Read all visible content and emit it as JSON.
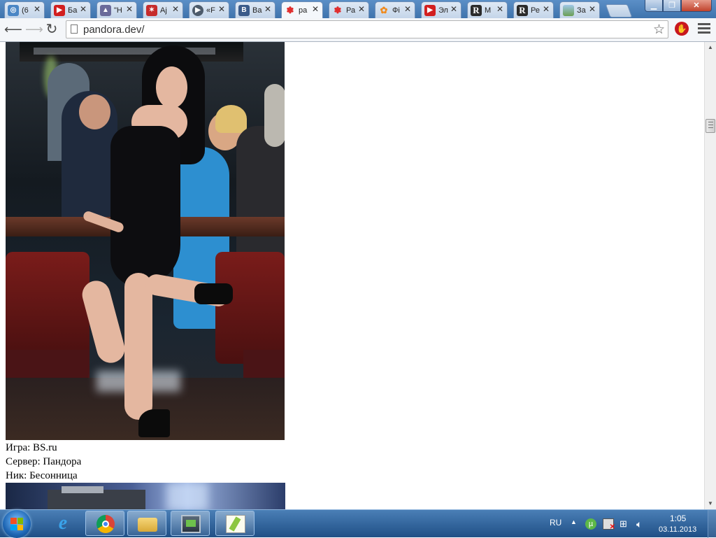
{
  "browser": {
    "tabs": [
      {
        "label": "(6",
        "icon": "chrome-app-icon",
        "color": "#4a86c5"
      },
      {
        "label": "Ба",
        "icon": "youtube-icon",
        "color": "#d21f1f"
      },
      {
        "label": "\"Н",
        "icon": "site-icon",
        "color": "#6a6a9a"
      },
      {
        "label": "Ај",
        "icon": "red-site-icon",
        "color": "#c62c2c"
      },
      {
        "label": "«F",
        "icon": "play-circle-icon",
        "color": "#4d5b6b"
      },
      {
        "label": "Ва",
        "icon": "vk-icon",
        "color": "#3b5b8a"
      },
      {
        "label": "ра",
        "icon": "yandex-icon",
        "color": "#e02d2d",
        "active": true
      },
      {
        "label": "Ра",
        "icon": "yandex-icon",
        "color": "#e02d2d"
      },
      {
        "label": "Фі",
        "icon": "flower-icon",
        "color": "#f08a1c"
      },
      {
        "label": "Эл",
        "icon": "youtube-icon",
        "color": "#d21f1f"
      },
      {
        "label": "М",
        "icon": "r-letter-icon",
        "color": "#2b2b2b"
      },
      {
        "label": "Ре",
        "icon": "r-letter-icon",
        "color": "#2b2b2b"
      },
      {
        "label": "За",
        "icon": "landscape-icon",
        "color": "#6b9f54"
      }
    ],
    "close_glyph": "✕",
    "url": "pandora.dev/",
    "star_glyph": "☆"
  },
  "page": {
    "caption_lines": [
      "Игра: BS.ru",
      "Сервер: Пандора",
      "Ник: Бесонница"
    ]
  },
  "taskbar": {
    "language": "RU",
    "time": "1:05",
    "date": "03.11.2013"
  }
}
